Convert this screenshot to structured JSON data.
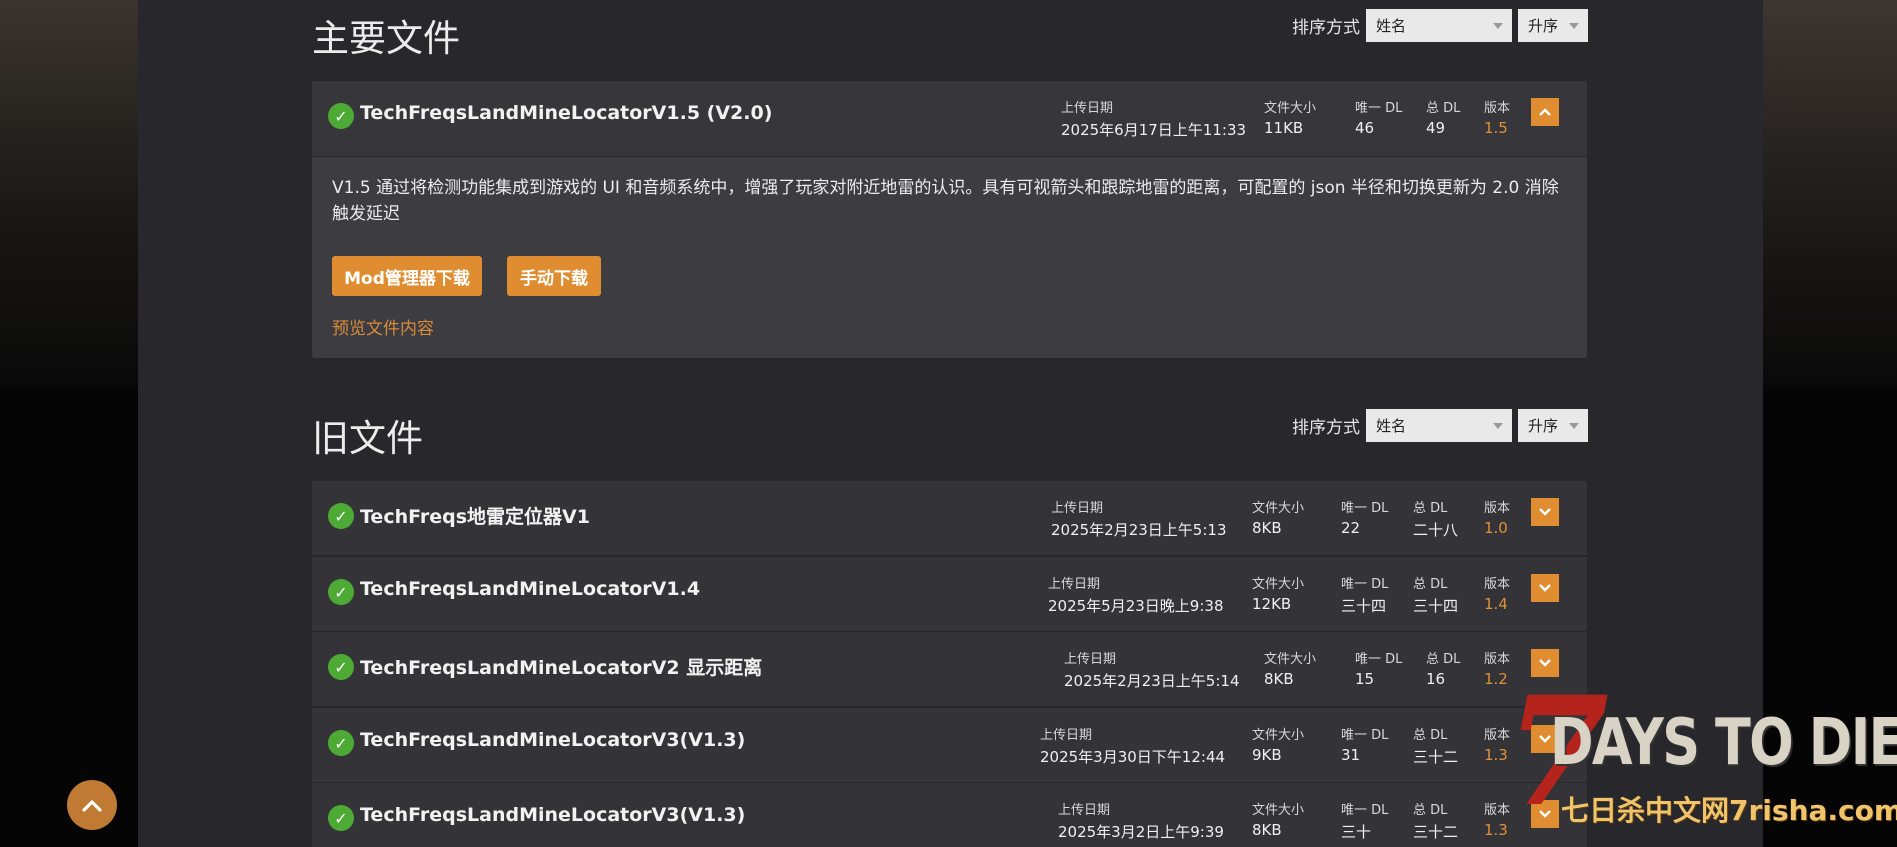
{
  "main_section": {
    "title": "主要文件",
    "sort_label": "排序方式",
    "sort_by": "姓名",
    "sort_order": "升序"
  },
  "old_section": {
    "title": "旧文件",
    "sort_label": "排序方式",
    "sort_by": "姓名",
    "sort_order": "升序"
  },
  "labels": {
    "upload_date": "上传日期",
    "file_size": "文件大小",
    "unique_dl": "唯一 DL",
    "total_dl": "总 DL",
    "version": "版本"
  },
  "main_file": {
    "name": "TechFreqsLandMineLocatorV1.5 (V2.0)",
    "upload_date": "2025年6月17日上午11:33",
    "size": "11KB",
    "unique_dl": "46",
    "total_dl": "49",
    "version": "1.5",
    "description": "V1.5 通过将检测功能集成到游戏的 UI 和音频系统中，增强了玩家对附近地雷的认识。具有可视箭头和跟踪地雷的距离，可配置的 json 半径和切换更新为 2.0 消除触发延迟",
    "mod_manager_button": "Mod管理器下载",
    "manual_button": "手动下载",
    "preview_link": "预览文件内容"
  },
  "old_files": [
    {
      "name": "TechFreqs地雷定位器V1",
      "upload_date": "2025年2月23日上午5:13",
      "size": "8KB",
      "unique_dl": "22",
      "total_dl": "二十八",
      "version": "1.0"
    },
    {
      "name": "TechFreqsLandMineLocatorV1.4",
      "upload_date": "2025年5月23日晚上9:38",
      "size": "12KB",
      "unique_dl": "三十四",
      "total_dl": "三十四",
      "version": "1.4"
    },
    {
      "name": "TechFreqsLandMineLocatorV2 显示距离",
      "upload_date": "2025年2月23日上午5:14",
      "size": "8KB",
      "unique_dl": "15",
      "total_dl": "16",
      "version": "1.2"
    },
    {
      "name": "TechFreqsLandMineLocatorV3(V1.3)",
      "upload_date": "2025年3月30日下午12:44",
      "size": "9KB",
      "unique_dl": "31",
      "total_dl": "三十二",
      "version": "1.3"
    },
    {
      "name": "TechFreqsLandMineLocatorV3(V1.3)",
      "upload_date": "2025年3月2日上午9:39",
      "size": "8KB",
      "unique_dl": "三十",
      "total_dl": "三十二",
      "version": "1.3"
    }
  ],
  "logo": {
    "seven": "7",
    "title": "DAYS TO DIE",
    "subtitle": "七日杀中文网7risha.com"
  },
  "colors": {
    "accent": "#df8d30",
    "check": "#4caa35",
    "version_orange": "#e0913a",
    "panel": "#28282c"
  }
}
